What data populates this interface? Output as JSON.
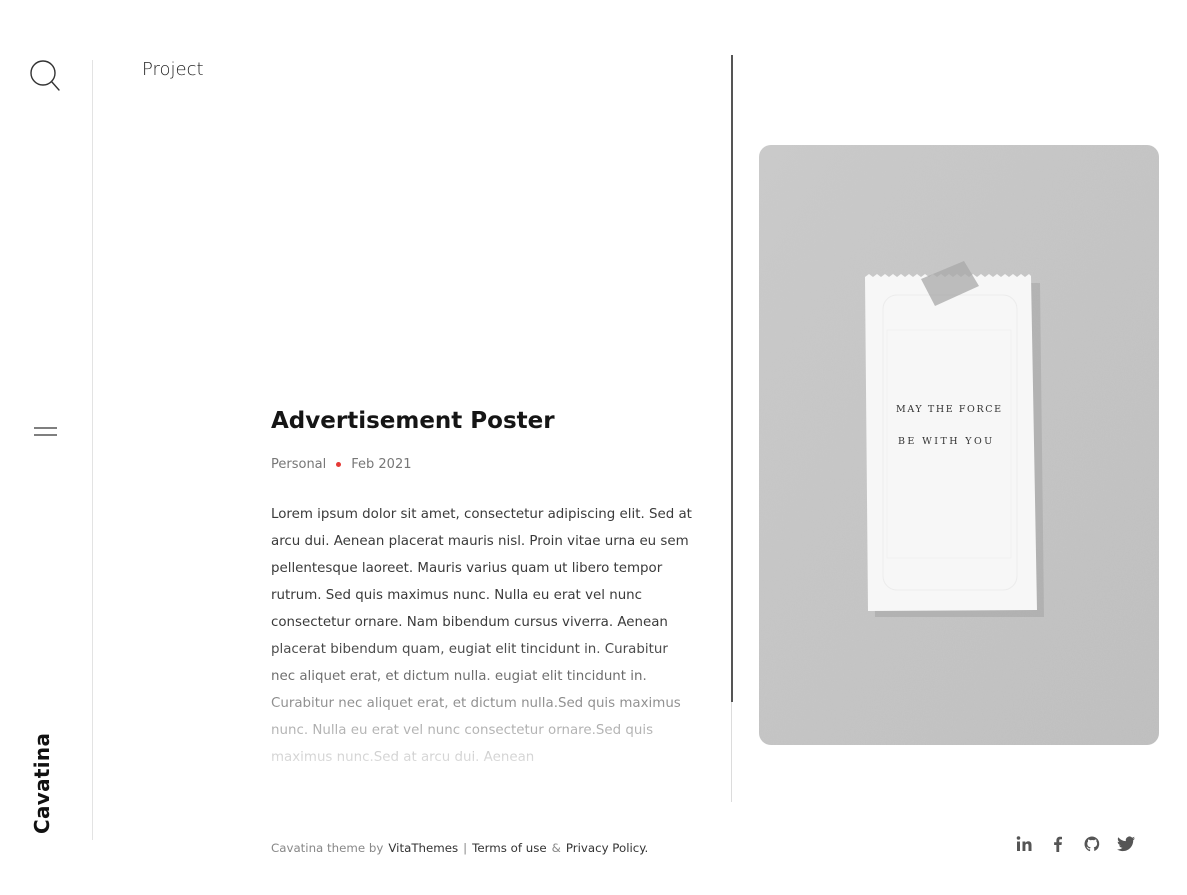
{
  "brand": {
    "name": "Cavatina"
  },
  "sidebar": {
    "search_icon": "search-icon",
    "menu_icon": "hamburger-icon"
  },
  "header": {
    "section_label": "Project"
  },
  "post": {
    "title": "Advertisement Poster",
    "category": "Personal",
    "date": "Feb 2021",
    "body": "Lorem ipsum dolor sit amet, consectetur adipiscing elit. Sed at arcu dui. Aenean placerat mauris nisl. Proin vitae urna eu sem pellentesque laoreet. Mauris varius quam ut libero tempor rutrum. Sed quis maximus nunc. Nulla eu erat vel nunc consectetur ornare. Nam bibendum cursus viverra. Aenean placerat bibendum quam, eugiat elit tincidunt in. Curabitur nec aliquet erat, et dictum nulla. eugiat elit tincidunt in. Curabitur nec aliquet erat, et dictum nulla.Sed quis maximus nunc. Nulla eu erat vel nunc consectetur ornare.Sed quis maximus nunc.Sed at arcu dui. Aenean",
    "meta_dot_color": "#e53935"
  },
  "hero_image": {
    "note_line1": "MAY THE FORCE",
    "note_line2": "BE WITH YOU"
  },
  "footer": {
    "credit_prefix": "Cavatina theme by",
    "credit_link": "VitaThemes",
    "separator": "|",
    "terms_link": "Terms of use",
    "amp": "&",
    "privacy_link": "Privacy Policy."
  },
  "social": [
    "linkedin-icon",
    "facebook-icon",
    "github-icon",
    "twitter-icon"
  ]
}
